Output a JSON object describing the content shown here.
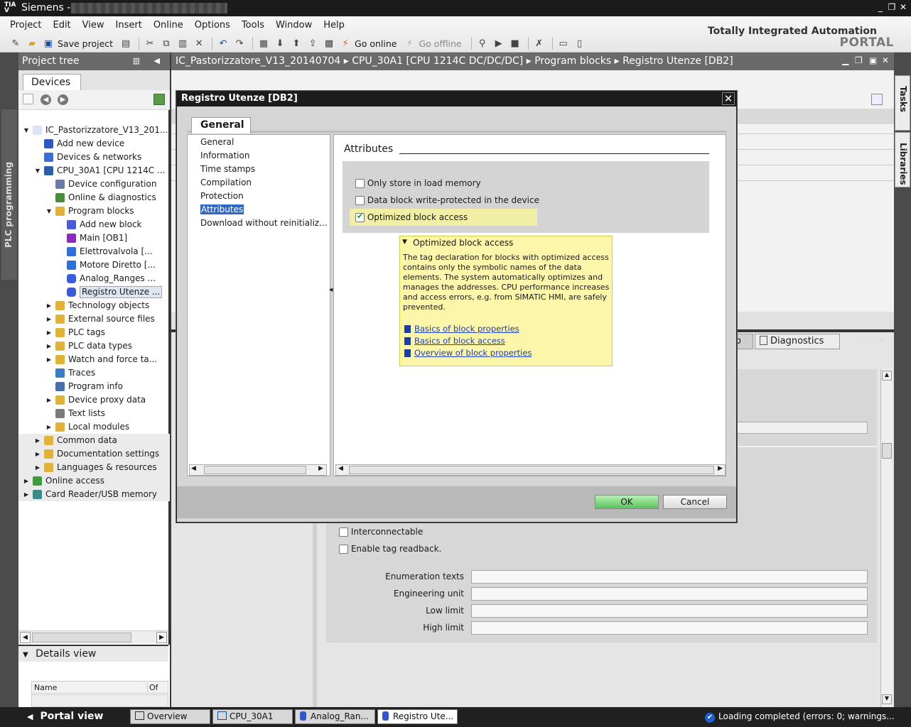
{
  "app": {
    "title": "Siemens  -",
    "brand_line1": "Totally Integrated Automation",
    "brand_line2": "PORTAL"
  },
  "menu": [
    "Project",
    "Edit",
    "View",
    "Insert",
    "Online",
    "Options",
    "Tools",
    "Window",
    "Help"
  ],
  "toolbar": {
    "save_label": "Save project",
    "go_online_label": "Go online",
    "go_offline_label": "Go offline"
  },
  "left_strip": {
    "label": "PLC programming"
  },
  "project_tree": {
    "header": "Project tree",
    "tab": "Devices",
    "items": [
      {
        "label": "IC_Pastorizzatore_V13_201...",
        "level": 0,
        "expander": "open",
        "icon": "doc-icon"
      },
      {
        "label": "Add new device",
        "level": 1,
        "expander": "none",
        "icon": "add-device-icon"
      },
      {
        "label": "Devices & networks",
        "level": 1,
        "expander": "none",
        "icon": "network-icon"
      },
      {
        "label": "CPU_30A1 [CPU 1214C ...",
        "level": 1,
        "expander": "open",
        "icon": "cpu-icon"
      },
      {
        "label": "Device configuration",
        "level": 2,
        "expander": "none",
        "icon": "device-config-icon"
      },
      {
        "label": "Online & diagnostics",
        "level": 2,
        "expander": "none",
        "icon": "diagnostics-icon"
      },
      {
        "label": "Program blocks",
        "level": 2,
        "expander": "open",
        "icon": "folder-icon"
      },
      {
        "label": "Add new block",
        "level": 3,
        "expander": "none",
        "icon": "add-block-icon"
      },
      {
        "label": "Main [OB1]",
        "level": 3,
        "expander": "none",
        "icon": "ob-icon"
      },
      {
        "label": "Elettrovalvola [...",
        "level": 3,
        "expander": "none",
        "icon": "fb-icon"
      },
      {
        "label": "Motore Diretto [...",
        "level": 3,
        "expander": "none",
        "icon": "fb-icon"
      },
      {
        "label": "Analog_Ranges ...",
        "level": 3,
        "expander": "none",
        "icon": "db-icon"
      },
      {
        "label": "Registro Utenze ...",
        "level": 3,
        "expander": "none",
        "icon": "db-icon",
        "selected": true
      },
      {
        "label": "Technology objects",
        "level": 2,
        "expander": "closed",
        "icon": "folder-icon"
      },
      {
        "label": "External source files",
        "level": 2,
        "expander": "closed",
        "icon": "folder-icon"
      },
      {
        "label": "PLC tags",
        "level": 2,
        "expander": "closed",
        "icon": "folder-icon"
      },
      {
        "label": "PLC data types",
        "level": 2,
        "expander": "closed",
        "icon": "folder-icon"
      },
      {
        "label": "Watch and force ta...",
        "level": 2,
        "expander": "closed",
        "icon": "folder-icon"
      },
      {
        "label": "Traces",
        "level": 2,
        "expander": "none",
        "icon": "trace-icon"
      },
      {
        "label": "Program info",
        "level": 2,
        "expander": "none",
        "icon": "info-icon"
      },
      {
        "label": "Device proxy data",
        "level": 2,
        "expander": "closed",
        "icon": "folder-icon"
      },
      {
        "label": "Text lists",
        "level": 2,
        "expander": "none",
        "icon": "textlist-icon"
      },
      {
        "label": "Local modules",
        "level": 2,
        "expander": "closed",
        "icon": "folder-icon"
      },
      {
        "label": "Common data",
        "level": 1,
        "expander": "closed",
        "icon": "folder-icon",
        "shaded": true
      },
      {
        "label": "Documentation settings",
        "level": 1,
        "expander": "closed",
        "icon": "folder-icon",
        "shaded": true
      },
      {
        "label": "Languages & resources",
        "level": 1,
        "expander": "closed",
        "icon": "folder-icon",
        "shaded": true
      },
      {
        "label": "Online access",
        "level": 0,
        "expander": "closed",
        "icon": "online-icon",
        "shaded": true
      },
      {
        "label": "Card Reader/USB memory",
        "level": 0,
        "expander": "closed",
        "icon": "card-icon",
        "shaded": true
      }
    ]
  },
  "details_view": {
    "header": "Details view",
    "col_name": "Name",
    "col_of": "Of"
  },
  "editor": {
    "breadcrumb": "IC_Pastorizzatore_V13_20140704  ▸  CPU_30A1 [CPU 1214C DC/DC/DC]  ▸  Program blocks  ▸  Registro Utenze [DB2]",
    "inspector_tab": "Diagnostics",
    "inspector_partial_tab": "o",
    "interconnectable_label": "Interconnectable",
    "tag_readback_label": "Enable tag readback.",
    "fields": [
      {
        "label": "Enumeration texts",
        "value": ""
      },
      {
        "label": "Engineering unit",
        "value": ""
      },
      {
        "label": "Low limit",
        "value": ""
      },
      {
        "label": "High limit",
        "value": ""
      }
    ]
  },
  "right_tabs": [
    "Tasks",
    "Libraries"
  ],
  "dialog": {
    "title": "Registro Utenze [DB2]",
    "tab": "General",
    "nav": [
      "General",
      "Information",
      "Time stamps",
      "Compilation",
      "Protection",
      "Attributes",
      "Download without reinitializ..."
    ],
    "active_nav": "Attributes",
    "section_title": "Attributes",
    "options": [
      {
        "label": "Only store in load memory",
        "checked": false
      },
      {
        "label": "Data block write-protected in the device",
        "checked": false
      },
      {
        "label": "Optimized block access",
        "checked": true
      }
    ],
    "tooltip": {
      "title": "Optimized block access",
      "body": "The tag declaration for blocks with optimized access contains only the symbolic names of the data elements. The system automatically optimizes and manages the addresses. CPU performance increases and access errors, e.g. from SIMATIC HMI, are safely prevented.",
      "links": [
        "Basics of block properties ",
        "Basics of block access",
        "Overview of block properties"
      ]
    },
    "ok_label": "OK",
    "cancel_label": "Cancel"
  },
  "statusbar": {
    "portal_view": "Portal view",
    "tasks": [
      {
        "label": "Overview",
        "icon": "overview-icon"
      },
      {
        "label": "CPU_30A1",
        "icon": "cpu-icon"
      },
      {
        "label": "Analog_Ran...",
        "icon": "db-icon"
      },
      {
        "label": "Registro Ute...",
        "icon": "db-icon"
      }
    ],
    "message": "Loading completed (errors: 0; warnings..."
  },
  "colors": {
    "title_bar": "#1b1b1b",
    "accent_selection": "#3069c4",
    "ok_button": "#5bc45b",
    "tooltip_bg": "#fbf6a9",
    "highlight": "#f1efa5"
  }
}
